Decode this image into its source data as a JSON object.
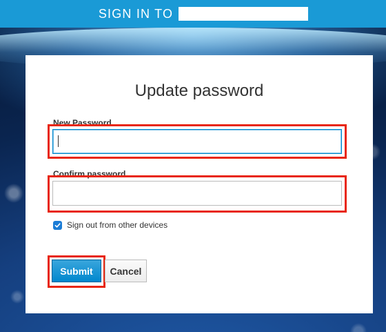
{
  "header": {
    "sign_in_label": "SIGN IN TO",
    "realm_name": ""
  },
  "form": {
    "title": "Update password",
    "new_password_label": "New Password",
    "new_password_value": "",
    "confirm_password_label": "Confirm password",
    "confirm_password_value": "",
    "signout_label": "Sign out from other devices",
    "signout_checked": true,
    "submit_label": "Submit",
    "cancel_label": "Cancel"
  },
  "colors": {
    "header_bg": "#1a9ad6",
    "highlight": "#e8260e",
    "primary_button": "#0088ce"
  }
}
